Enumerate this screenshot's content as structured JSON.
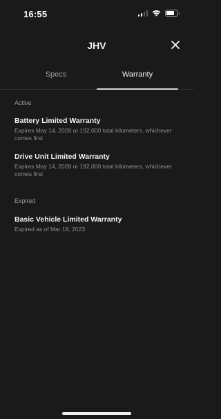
{
  "status_bar": {
    "time": "16:55",
    "icons": [
      "cellular-signal-icon",
      "wifi-icon",
      "battery-icon"
    ]
  },
  "header": {
    "title": "JHV",
    "close_icon": "close-icon"
  },
  "tabs": [
    {
      "label": "Specs",
      "selected": false
    },
    {
      "label": "Warranty",
      "selected": true
    }
  ],
  "sections": {
    "active": {
      "label": "Active",
      "items": [
        {
          "title": "Battery Limited Warranty",
          "subtitle": "Expires May 14, 2028 or 192,000 total kilometers, whichever comes first"
        },
        {
          "title": "Drive Unit Limited Warranty",
          "subtitle": "Expires May 14, 2028 or 192,000 total kilometers, whichever comes first"
        }
      ]
    },
    "expired": {
      "label": "Expired",
      "items": [
        {
          "title": "Basic Vehicle Limited Warranty",
          "subtitle": "Expired as of Mar 18, 2023"
        }
      ]
    }
  },
  "colors": {
    "background": "#1a1a1b",
    "text_primary": "#f2f2f3",
    "text_secondary": "#8f8f92",
    "tab_indicator": "#d9d9db"
  }
}
